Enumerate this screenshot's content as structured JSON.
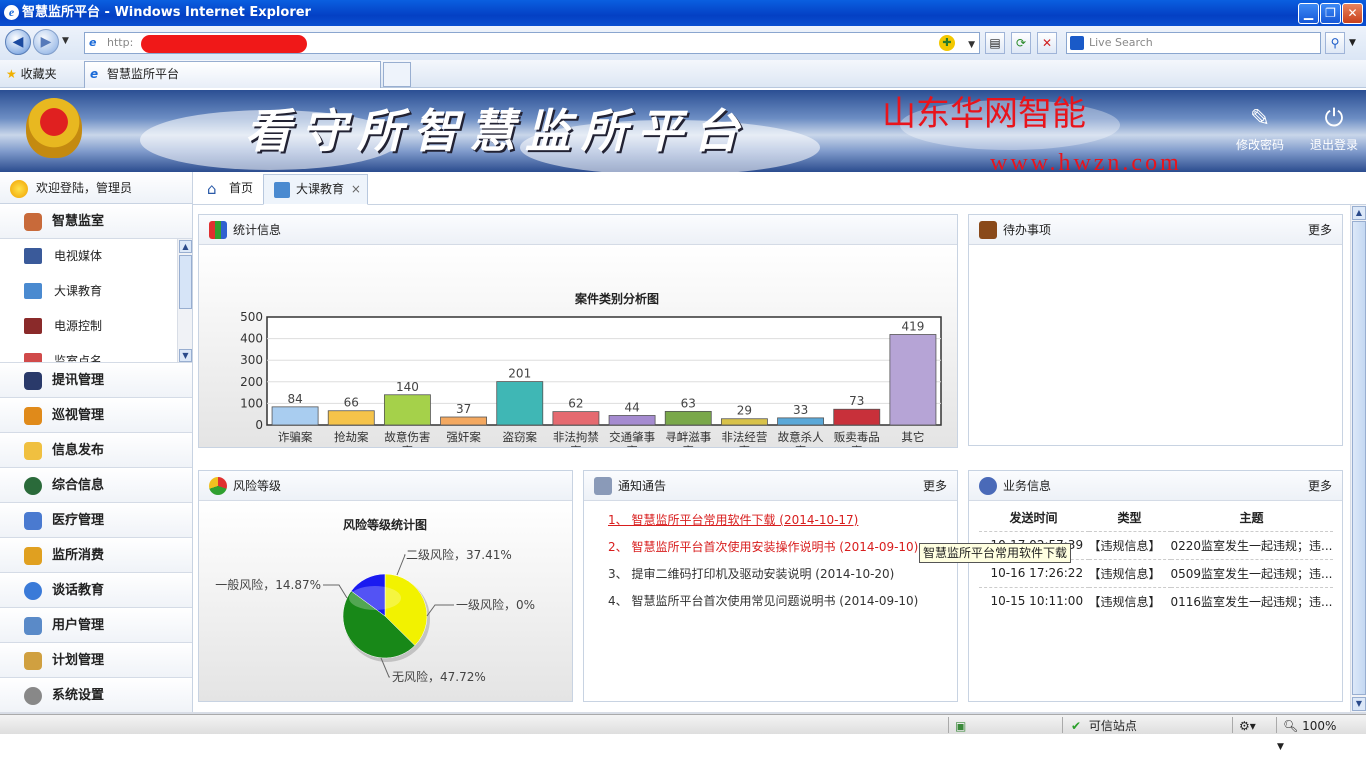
{
  "window": {
    "title": "智慧监所平台 - Windows Internet Explorer"
  },
  "browser": {
    "url_prefix": "http:",
    "search_placeholder": "Live Search",
    "favorites_label": "收藏夹",
    "tab_title": "智慧监所平台"
  },
  "banner": {
    "title": "看守所智慧监所平台",
    "brand": "山东华网智能",
    "brand_url": "www.hwzn.com",
    "change_password": "修改密码",
    "logout": "退出登录"
  },
  "sidebar": {
    "welcome": "欢迎登陆，管理员",
    "active_group": "智慧监室",
    "sub_items": [
      "电视媒体",
      "大课教育",
      "电源控制",
      "监室点名"
    ],
    "groups": [
      "提讯管理",
      "巡视管理",
      "信息发布",
      "综合信息",
      "医疗管理",
      "监所消费",
      "谈话教育",
      "用户管理",
      "计划管理",
      "系统设置"
    ]
  },
  "content_tabs": [
    {
      "label": "首页"
    },
    {
      "label": "大课教育",
      "close": "×"
    }
  ],
  "stats_panel": {
    "title": "统计信息"
  },
  "todo_panel": {
    "title": "待办事项",
    "more": "更多"
  },
  "risk_panel": {
    "title": "风险等级"
  },
  "notice_panel": {
    "title": "通知通告",
    "more": "更多",
    "items": [
      "1、 智慧监所平台常用软件下载 (2014-10-17)",
      "2、 智慧监所平台首次使用安装操作说明书 (2014-09-10)",
      "3、 提审二维码打印机及驱动安装说明 (2014-10-20)",
      "4、 智慧监所平台首次使用常见问题说明书 (2014-09-10)"
    ]
  },
  "tooltip": "智慧监所平台常用软件下载",
  "biz_panel": {
    "title": "业务信息",
    "more": "更多",
    "headers": [
      "发送时间",
      "类型",
      "主题"
    ],
    "rows": [
      [
        "10-17 02:57:39",
        "【违规信息】",
        "0220监室发生一起违规；违..."
      ],
      [
        "10-16 17:26:22",
        "【违规信息】",
        "0509监室发生一起违规；违..."
      ],
      [
        "10-15 10:11:00",
        "【违规信息】",
        "0116监室发生一起违规；违..."
      ]
    ]
  },
  "status": {
    "trusted": "可信站点",
    "zoom": "100%"
  },
  "chart_data": [
    {
      "type": "bar",
      "title": "案件类别分析图",
      "categories": [
        "诈骗案",
        "抢劫案",
        "故意伤害案",
        "强奸案",
        "盗窃案",
        "非法拘禁案",
        "交通肇事案",
        "寻衅滋事案",
        "非法经营案",
        "故意杀人案",
        "贩卖毒品案",
        "其它"
      ],
      "values": [
        84,
        66,
        140,
        37,
        201,
        62,
        44,
        63,
        29,
        33,
        73,
        419
      ],
      "ylim": [
        0,
        500
      ],
      "yticks": [
        0,
        100,
        200,
        300,
        400,
        500
      ],
      "colors": [
        "#a9cdf0",
        "#f5c34a",
        "#a5d14a",
        "#f3a860",
        "#3fb7b5",
        "#e56a70",
        "#a58bd0",
        "#7aa84a",
        "#d8c24a",
        "#5aa8d8",
        "#c8303a",
        "#b6a4d6"
      ],
      "grid": true
    },
    {
      "type": "pie",
      "title": "风险等级统计图",
      "slices": [
        {
          "label": "二级风险",
          "value": 37.41,
          "text": "二级风险，37.41%",
          "color": "#f2f200"
        },
        {
          "label": "一级风险",
          "value": 0,
          "text": "一级风险，0%",
          "color": "#e83030"
        },
        {
          "label": "无风险",
          "value": 47.72,
          "text": "无风险，47.72%",
          "color": "#188818"
        },
        {
          "label": "一般风险",
          "value": 14.87,
          "text": "一般风险，14.87%",
          "color": "#1a1af0"
        }
      ]
    }
  ]
}
